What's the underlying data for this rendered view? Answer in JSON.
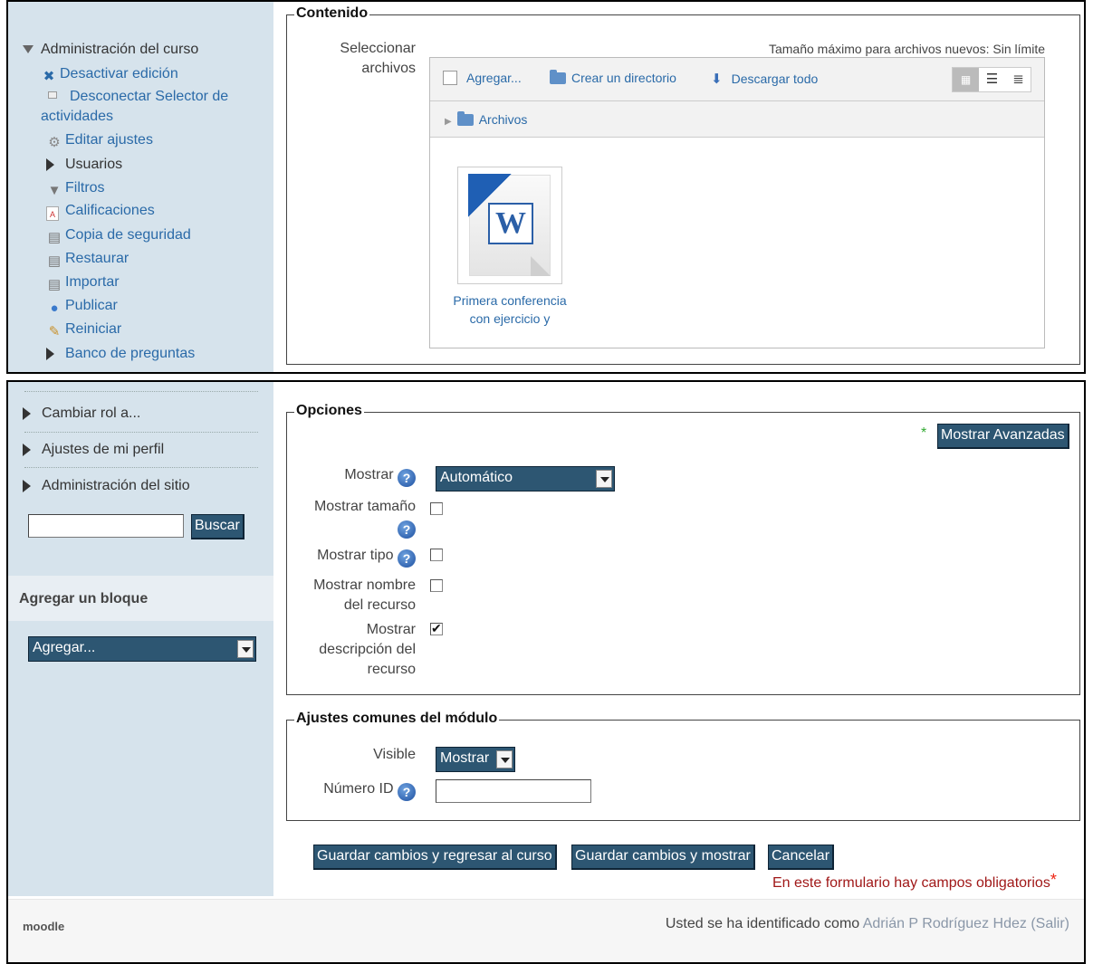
{
  "top_sidebar": {
    "section": "Administración del curso",
    "items": [
      {
        "label": "Desactivar edición",
        "icon": "tools-icon"
      },
      {
        "label": "Desconectar Selector de",
        "label2": "actividades",
        "icon": "bullet-icon"
      },
      {
        "label": "Editar ajustes",
        "icon": "gear-icon"
      },
      {
        "label": "Usuarios",
        "icon": "expand-icon"
      },
      {
        "label": "Filtros",
        "icon": "funnel-icon"
      },
      {
        "label": "Calificaciones",
        "icon": "grades-icon"
      },
      {
        "label": "Copia de seguridad",
        "icon": "backup-icon"
      },
      {
        "label": "Restaurar",
        "icon": "restore-icon"
      },
      {
        "label": "Importar",
        "icon": "import-icon"
      },
      {
        "label": "Publicar",
        "icon": "publish-icon"
      },
      {
        "label": "Reiniciar",
        "icon": "broom-icon"
      },
      {
        "label": "Banco de preguntas",
        "icon": "expand-icon"
      }
    ]
  },
  "contenido": {
    "legend": "Contenido",
    "select_label_1": "Seleccionar",
    "select_label_2": "archivos",
    "max_size": "Tamaño máximo para archivos nuevos: Sin límite",
    "toolbar": {
      "add": "Agregar...",
      "mkdir": "Crear un directorio",
      "download": "Descargar todo"
    },
    "breadcrumb": "Archivos",
    "file_name_1": "Primera conferencia",
    "file_name_2": "con ejercicio y"
  },
  "bottom_sidebar": {
    "items": [
      "Cambiar rol a...",
      "Ajustes de mi perfil",
      "Administración del sitio"
    ],
    "search_button": "Buscar",
    "search_value": "",
    "add_block_title": "Agregar un bloque",
    "add_block_select": "Agregar..."
  },
  "opciones": {
    "legend": "Opciones",
    "advanced_button": "Mostrar Avanzadas",
    "asterisk": "*",
    "mostrar_label": "Mostrar",
    "mostrar_value": "Automático",
    "size_label_1": "Mostrar tamaño",
    "type_label": "Mostrar tipo",
    "name_label_1": "Mostrar nombre",
    "name_label_2": "del recurso",
    "desc_label_1": "Mostrar",
    "desc_label_2": "descripción del",
    "desc_label_3": "recurso",
    "checks": {
      "size": false,
      "type": false,
      "name": false,
      "desc": true
    }
  },
  "comunes": {
    "legend": "Ajustes comunes del módulo",
    "visible_label": "Visible",
    "visible_value": "Mostrar",
    "id_label": "Número ID",
    "id_value": ""
  },
  "actions": {
    "save_return": "Guardar cambios y regresar al curso",
    "save_show": "Guardar cambios y mostrar",
    "cancel": "Cancelar",
    "required_note": "En este formulario hay campos obligatorios",
    "required_star": "*"
  },
  "footer": {
    "logo": "moodle",
    "logged_prefix": "Usted se ha identificado como",
    "user": "Adrián P Rodríguez Hdez",
    "logout": "(Salir)"
  }
}
